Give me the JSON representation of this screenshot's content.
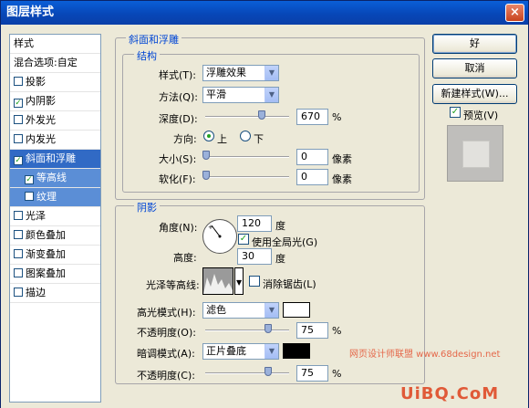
{
  "window": {
    "title": "图层样式",
    "close_glyph": "×"
  },
  "left_list": {
    "header": "样式",
    "items": [
      {
        "label": "混合选项:自定",
        "checkbox": false,
        "checked": false
      },
      {
        "label": "投影",
        "checkbox": true,
        "checked": false
      },
      {
        "label": "内阴影",
        "checkbox": true,
        "checked": true
      },
      {
        "label": "外发光",
        "checkbox": true,
        "checked": false
      },
      {
        "label": "内发光",
        "checkbox": true,
        "checked": false
      },
      {
        "label": "斜面和浮雕",
        "checkbox": true,
        "checked": true
      },
      {
        "label": "等高线",
        "checkbox": true,
        "checked": true
      },
      {
        "label": "纹理",
        "checkbox": true,
        "checked": false
      },
      {
        "label": "光泽",
        "checkbox": true,
        "checked": false
      },
      {
        "label": "颜色叠加",
        "checkbox": true,
        "checked": false
      },
      {
        "label": "渐变叠加",
        "checkbox": true,
        "checked": false
      },
      {
        "label": "图案叠加",
        "checkbox": true,
        "checked": false
      },
      {
        "label": "描边",
        "checkbox": true,
        "checked": false
      }
    ]
  },
  "bevel": {
    "group_title": "斜面和浮雕",
    "structure_title": "结构",
    "style_label": "样式(T):",
    "style_value": "浮雕效果",
    "technique_label": "方法(Q):",
    "technique_value": "平滑",
    "depth_label": "深度(D):",
    "depth_value": "670",
    "depth_unit": "%",
    "depth_fraction": 0.67,
    "direction_label": "方向:",
    "direction_up": "上",
    "direction_down": "下",
    "size_label": "大小(S):",
    "size_value": "0",
    "size_unit": "像素",
    "soften_label": "软化(F):",
    "soften_value": "0",
    "soften_unit": "像素"
  },
  "shading": {
    "group_title": "阴影",
    "angle_label": "角度(N):",
    "angle_value": "120",
    "angle_unit": "度",
    "global_light_label": "使用全局光(G)",
    "global_light_checked": true,
    "altitude_label": "高度:",
    "altitude_value": "30",
    "altitude_unit": "度",
    "gloss_contour_label": "光泽等高线:",
    "anti_aliased_label": "消除锯齿(L)",
    "anti_aliased_checked": false,
    "highlight_mode_label": "高光模式(H):",
    "highlight_mode_value": "滤色",
    "highlight_color": "#ffffff",
    "highlight_opacity_label": "不透明度(O):",
    "highlight_opacity_value": "75",
    "opacity_unit": "%",
    "shadow_mode_label": "暗调模式(A):",
    "shadow_mode_value": "正片叠底",
    "shadow_color": "#000000",
    "shadow_opacity_label": "不透明度(C):",
    "shadow_opacity_value": "75",
    "opacity_fraction": 0.75
  },
  "buttons": {
    "ok": "好",
    "cancel": "取消",
    "new_style": "新建样式(W)...",
    "preview_label": "预览(V)",
    "preview_checked": true
  },
  "watermark": {
    "line1": "网页设计师联盟 www.68design.net",
    "line2": "UiBQ.CoM"
  },
  "colors": {
    "accent": "#316ac5",
    "title_bar": "#0a5fd8",
    "legend_text": "#0046d5",
    "dialog_bg": "#ece9d8"
  }
}
